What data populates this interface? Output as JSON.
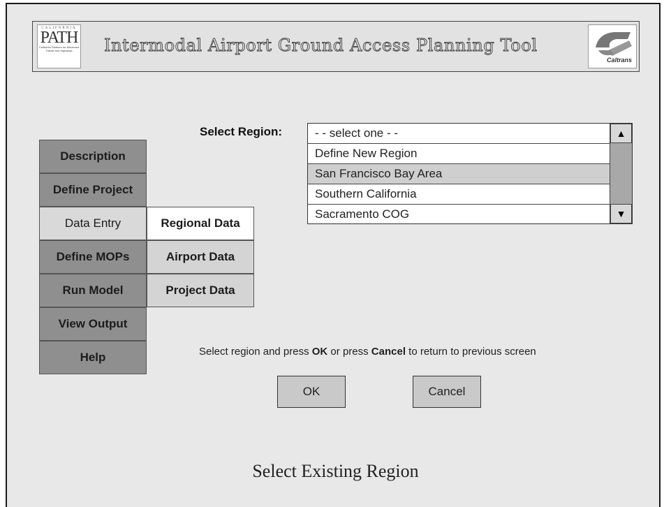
{
  "header": {
    "title": "Intermodal Airport Ground Access Planning Tool",
    "path_logo": {
      "top": "CALIFORNIA",
      "main": "PATH",
      "sub": "California Partners for Advanced Transit and Highways"
    },
    "caltrans_logo": {
      "text": "Caltrans"
    }
  },
  "nav": {
    "items": [
      {
        "label": "Description",
        "state": "normal"
      },
      {
        "label": "Define Project",
        "state": "normal"
      },
      {
        "label": "Data Entry",
        "state": "active"
      },
      {
        "label": "Define MOPs",
        "state": "normal"
      },
      {
        "label": "Run Model",
        "state": "normal"
      },
      {
        "label": "View Output",
        "state": "normal"
      },
      {
        "label": "Help",
        "state": "normal"
      }
    ],
    "submenu": [
      {
        "label": "Regional Data",
        "state": "active"
      },
      {
        "label": "Airport Data",
        "state": "normal"
      },
      {
        "label": "Project Data",
        "state": "normal"
      }
    ]
  },
  "region": {
    "label": "Select Region:",
    "options": [
      "- - select one - -",
      "Define New Region",
      "San Francisco Bay Area",
      "Southern California",
      "Sacramento COG"
    ],
    "selected": "San Francisco Bay Area"
  },
  "scrollbar": {
    "up_icon": "triangle-up-icon",
    "down_icon": "triangle-down-icon",
    "up_glyph": "▲",
    "down_glyph": "▼"
  },
  "instruction": {
    "part1": "Select region and press ",
    "ok": "OK",
    "part2": " or press ",
    "cancel": "Cancel",
    "part3": " to return to previous screen"
  },
  "buttons": {
    "ok": "OK",
    "cancel": "Cancel"
  },
  "footer": {
    "title": "Select Existing Region"
  }
}
